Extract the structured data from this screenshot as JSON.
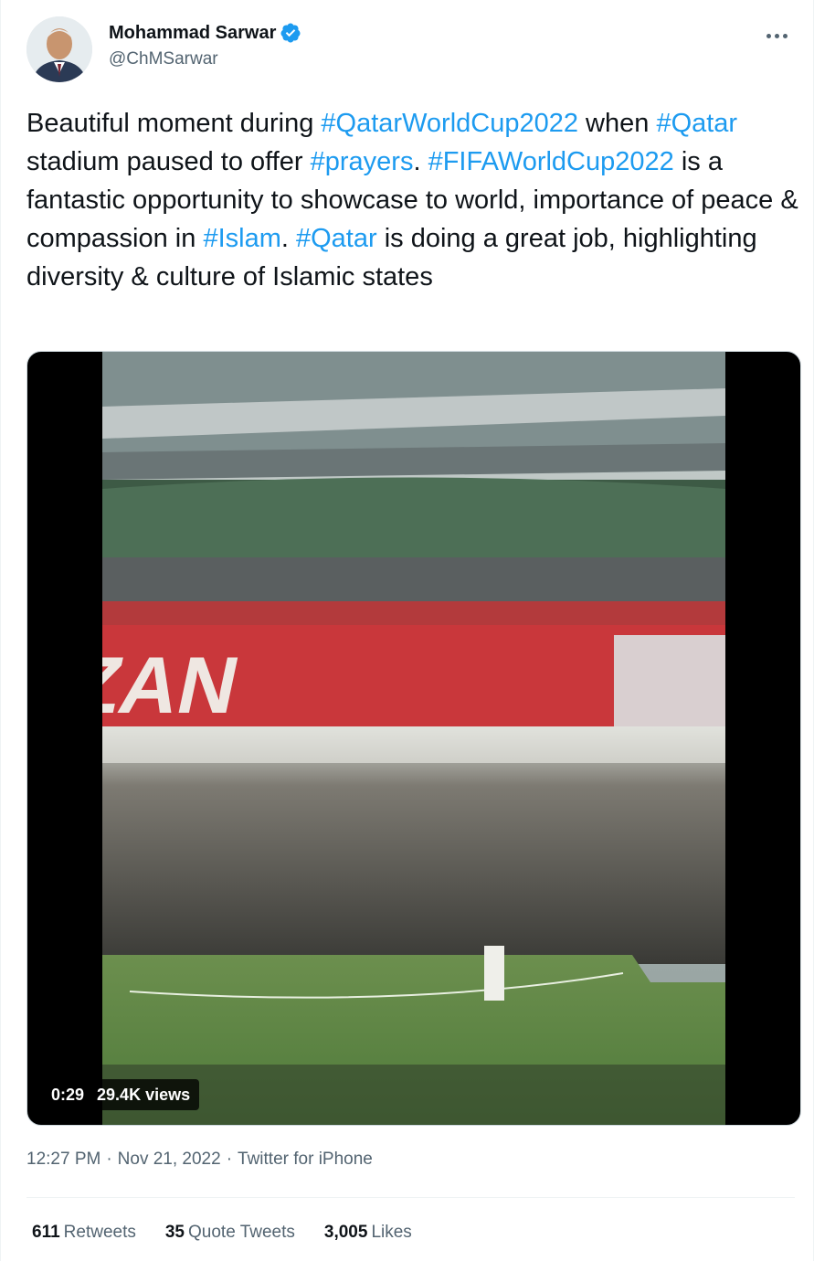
{
  "author": {
    "display_name": "Mohammad Sarwar",
    "handle": "@ChMSarwar",
    "verified": true
  },
  "tweet": {
    "segments": [
      {
        "text": "Beautiful moment during ",
        "hashtag": false
      },
      {
        "text": "#QatarWorldCup2022",
        "hashtag": true
      },
      {
        "text": " when ",
        "hashtag": false
      },
      {
        "text": "#Qatar",
        "hashtag": true
      },
      {
        "text": " stadium paused to offer ",
        "hashtag": false
      },
      {
        "text": "#prayers",
        "hashtag": true
      },
      {
        "text": ". ",
        "hashtag": false
      },
      {
        "text": "#FIFAWorldCup2022",
        "hashtag": true
      },
      {
        "text": " is a fantastic opportunity to showcase to world, importance of peace & compassion in ",
        "hashtag": false
      },
      {
        "text": "#Islam",
        "hashtag": true
      },
      {
        "text": ". ",
        "hashtag": false
      },
      {
        "text": "#Qatar",
        "hashtag": true
      },
      {
        "text": " is doing a great job, highlighting diversity & culture of Islamic states",
        "hashtag": false
      }
    ]
  },
  "media": {
    "duration": "0:29",
    "views": "29.4K views"
  },
  "meta": {
    "time": "12:27 PM",
    "separator": "·",
    "date": "Nov 21, 2022",
    "source": "Twitter for iPhone"
  },
  "stats": {
    "retweets_count": "611",
    "retweets_label": "Retweets",
    "quotes_count": "35",
    "quotes_label": "Quote Tweets",
    "likes_count": "3,005",
    "likes_label": "Likes"
  },
  "colors": {
    "link": "#1d9bf0",
    "secondary_text": "#536471",
    "primary_text": "#0f1419"
  },
  "icons": {
    "verified": "verified-badge-icon",
    "more": "more-options-icon"
  }
}
